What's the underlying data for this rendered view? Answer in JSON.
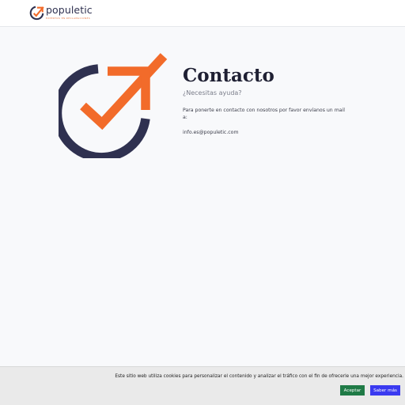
{
  "header": {
    "brand_name": "populetic",
    "brand_tagline": "expertos en reclamaciones"
  },
  "main": {
    "title": "Contacto",
    "subtitle": "¿Necesitas ayuda?",
    "message": "Para ponerte en contacto con nosotros por favor envíanos un mail a:",
    "email": "info.es@populetic.com"
  },
  "cookie_banner": {
    "text": "Este sitio web utiliza cookies para personalizar el contenido y analizar el tráfico con el fin de ofrecerle una mejor experiencia.",
    "accept_label": "Aceptar",
    "more_label": "Saber más"
  },
  "colors": {
    "brand_navy": "#2f3150",
    "brand_orange": "#f26b2a",
    "accept_green": "#1f7a46",
    "more_blue": "#3a3af0"
  },
  "icons": {
    "brand_logo": "plane-check-logo-icon",
    "hero_logo": "plane-check-logo-icon"
  }
}
